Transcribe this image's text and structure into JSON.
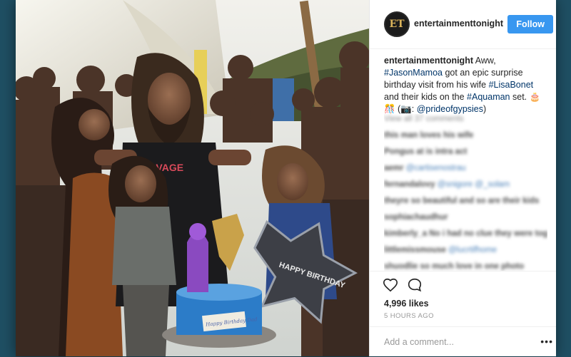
{
  "post": {
    "account": {
      "username": "entertainmenttonight",
      "avatar_text": "ET",
      "follow_label": "Follow"
    },
    "caption": {
      "username": "entertainmenttonight",
      "text_1": " Aww, ",
      "tag_1": "#JasonMamoa",
      "text_2": " got an epic surprise birthday visit from his wife ",
      "tag_2": "#LisaBonet",
      "text_3": " and their kids on the ",
      "tag_3": "#Aquaman",
      "text_4": " set. 🎂🎊 (📷: ",
      "tag_4": "@prideofgypsies",
      "text_5": ")"
    },
    "comments": [
      {
        "user": "",
        "text": "View all 37 comments"
      },
      {
        "user": "",
        "text": "this man loves his wife"
      },
      {
        "user": "",
        "text": "Pongus at is intra act"
      },
      {
        "user": "",
        "text": "aemr",
        "mention": "@cartisenostrau"
      },
      {
        "user": "",
        "text": "fernandalovy",
        "mention": "@snigore @_solam"
      },
      {
        "user": "",
        "text": "theyre so beautiful and so are their kids"
      },
      {
        "user": "",
        "text": "sophiachaudhur"
      },
      {
        "user": "",
        "text": "kimberly_a No i had no clue they were together"
      },
      {
        "user": "",
        "text": "littlemissmouse",
        "mention": "@lucrtifhome"
      },
      {
        "user": "",
        "text": "shuodlie so much love in one photo"
      }
    ],
    "likes": "4,996 likes",
    "timestamp": "5 HOURS AGO",
    "comment_placeholder": "Add a comment...",
    "more_label": "•••"
  },
  "photo": {
    "shirt_text": "SAVAGE",
    "balloon_text": "HAPPY BIRTHDAY",
    "cake_text": "Happy Birthday Dad"
  },
  "colors": {
    "background": "#1f4f63",
    "follow_button": "#3897f0",
    "hashtag": "#003569"
  },
  "icons": [
    "heart-icon",
    "comment-bubble-icon",
    "more-options-icon"
  ]
}
